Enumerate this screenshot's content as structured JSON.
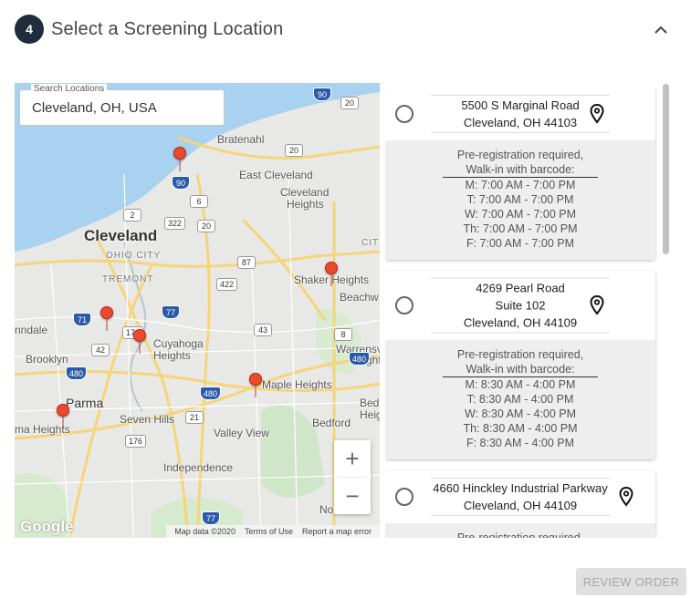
{
  "step": {
    "number": "4",
    "title": "Select a Screening Location"
  },
  "search": {
    "legend": "Search Locations",
    "value": "Cleveland, OH, USA"
  },
  "map": {
    "labels": [
      "Bratenahl",
      "East Cleveland",
      "Cleveland",
      "Heights",
      "Cleveland",
      "OHIO CITY",
      "TREMONT",
      "Shaker Heights",
      "Beachw",
      "Cuyahoga",
      "Heights",
      "Brooklyn",
      "nndale",
      "Warrensv",
      "Heights",
      "Maple Heights",
      "Parma",
      "ma Heights",
      "Seven Hills",
      "Valley View",
      "Bedford",
      "Bedf",
      "Heig",
      "Independence",
      "Nor",
      "CITY"
    ],
    "shields": [
      "90",
      "20",
      "90",
      "6",
      "2",
      "322",
      "20",
      "20",
      "87",
      "422",
      "71",
      "42",
      "176",
      "77",
      "43",
      "8",
      "480",
      "480",
      "480",
      "21",
      "176",
      "77"
    ],
    "zoom_in": "+",
    "zoom_out": "−",
    "google": "Google",
    "attribution": [
      "Map data ©2020",
      "Terms of Use",
      "Report a map error"
    ]
  },
  "locations": [
    {
      "address": [
        "5500 S Marginal Road",
        "Cleveland, OH 44103"
      ],
      "prereg": "Pre-registration required,",
      "walkin": "Walk-in with barcode:",
      "hours": [
        "M: 7:00 AM - 7:00 PM",
        "T: 7:00 AM - 7:00 PM",
        "W: 7:00 AM - 7:00 PM",
        "Th: 7:00 AM - 7:00 PM",
        "F: 7:00 AM - 7:00 PM"
      ]
    },
    {
      "address": [
        "4269 Pearl Road",
        "Suite 102",
        "Cleveland, OH 44109"
      ],
      "prereg": "Pre-registration required,",
      "walkin": "Walk-in with barcode:",
      "hours": [
        "M: 8:30 AM - 4:00 PM",
        "T: 8:30 AM - 4:00 PM",
        "W: 8:30 AM - 4:00 PM",
        "Th: 8:30 AM - 4:00 PM",
        "F: 8:30 AM - 4:00 PM"
      ]
    },
    {
      "address": [
        "4660 Hinckley Industrial Parkway",
        "Cleveland, OH 44109"
      ],
      "prereg": "Pre-registration required,"
    }
  ],
  "review_button": "REVIEW ORDER",
  "colors": {
    "badge": "#1f2d3d",
    "pin": "#ea4b2a",
    "water": "#a9d2f0",
    "road": "#f7d477"
  }
}
